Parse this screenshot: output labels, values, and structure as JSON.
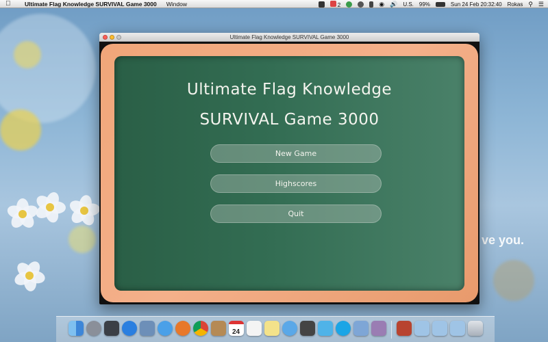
{
  "menubar": {
    "app_name": "Ultimate Flag Knowledge SURVIVAL Game 3000",
    "menu_window": "Window",
    "gmail_count": "2",
    "battery": "99%",
    "input_source": "U.S.",
    "datetime": "Sun 24 Feb  20:32:40",
    "user": "Rokas"
  },
  "window": {
    "title": "Ultimate Flag Knowledge SURVIVAL Game 3000"
  },
  "game": {
    "title_line1": "Ultimate Flag Knowledge",
    "title_line2": "SURVIVAL Game 3000",
    "buttons": {
      "new_game": "New Game",
      "highscores": "Highscores",
      "quit": "Quit"
    }
  },
  "wallpaper_text": "ve you.",
  "colors": {
    "board": "#336d53",
    "frame": "#f0a679",
    "chalk": "#f4f4ee"
  },
  "dock": {
    "icons": [
      "finder-icon",
      "launchpad-icon",
      "mission-control-icon",
      "app-store-icon",
      "preview-icon",
      "safari-icon",
      "firefox-icon",
      "chrome-icon",
      "contacts-icon",
      "calendar-icon",
      "reminders-icon",
      "notes-icon",
      "itunes-icon",
      "photo-booth-icon",
      "twitter-icon",
      "skype-icon",
      "xcode-icon",
      "script-icon",
      "photo-icon",
      "folder-icon",
      "folder-icon",
      "folder-icon",
      "trash-icon"
    ],
    "calendar_day": "24"
  }
}
